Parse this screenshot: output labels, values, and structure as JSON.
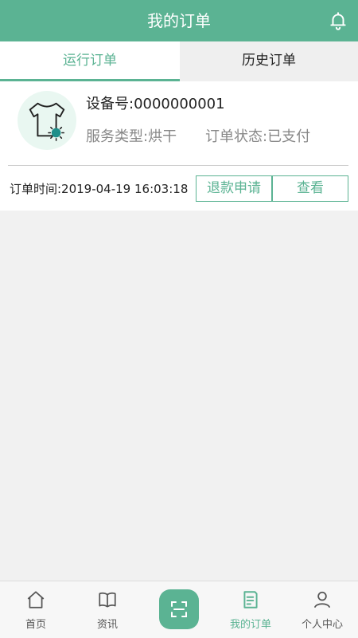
{
  "header": {
    "title": "我的订单",
    "right_icon": "bell-icon"
  },
  "tabs": [
    {
      "label": "运行订单",
      "active": true
    },
    {
      "label": "历史订单",
      "active": false
    }
  ],
  "order": {
    "icon": "shirt-dryer-icon",
    "device_label": "设备号:0000000001",
    "service_type": "服务类型:烘干",
    "status": "订单状态:已支付",
    "order_time": "订单时间:2019-04-19 16:03:18",
    "refund_button": "退款申请",
    "view_button": "查看"
  },
  "bottom_nav": {
    "items": [
      {
        "label": "首页",
        "icon": "home-icon",
        "active": false
      },
      {
        "label": "资讯",
        "icon": "book-icon",
        "active": false
      },
      {
        "label": "",
        "icon": "scan-icon",
        "active": false
      },
      {
        "label": "我的订单",
        "icon": "order-list-icon",
        "active": true
      },
      {
        "label": "个人中心",
        "icon": "user-icon",
        "active": false
      }
    ]
  },
  "colors": {
    "accent": "#5bb393",
    "background": "#f1f1f1",
    "muted_text": "#888888"
  }
}
